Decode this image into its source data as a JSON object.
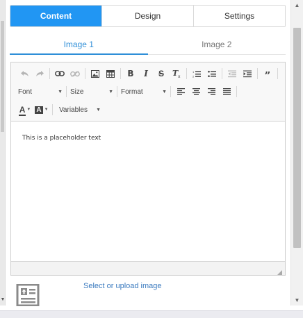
{
  "top_tabs": [
    {
      "label": "Content",
      "active": true
    },
    {
      "label": "Design",
      "active": false
    },
    {
      "label": "Settings",
      "active": false
    }
  ],
  "sub_tabs": [
    {
      "label": "Image 1",
      "active": true
    },
    {
      "label": "Image 2",
      "active": false
    }
  ],
  "toolbar": {
    "row1": [
      "undo-icon",
      "redo-icon",
      "link-icon",
      "unlink-icon",
      "image-icon",
      "table-icon",
      "bold-icon",
      "italic-icon",
      "strikethrough-icon",
      "remove-format-icon",
      "numbered-list-icon",
      "bulleted-list-icon",
      "outdent-icon",
      "indent-icon",
      "blockquote-icon"
    ],
    "bold_glyph": "B",
    "italic_glyph": "I",
    "strike_glyph": "S",
    "clear_glyph": "T",
    "quote_glyph": "”",
    "font_label": "Font",
    "size_label": "Size",
    "format_label": "Format",
    "text_color_glyph": "A",
    "bg_color_glyph": "A",
    "variables_label": "Variables"
  },
  "editor": {
    "content_text": "This is a placeholder text"
  },
  "image": {
    "select_label": "Select or upload image"
  },
  "colors": {
    "accent": "#2196f3",
    "link": "#3a7abf"
  }
}
